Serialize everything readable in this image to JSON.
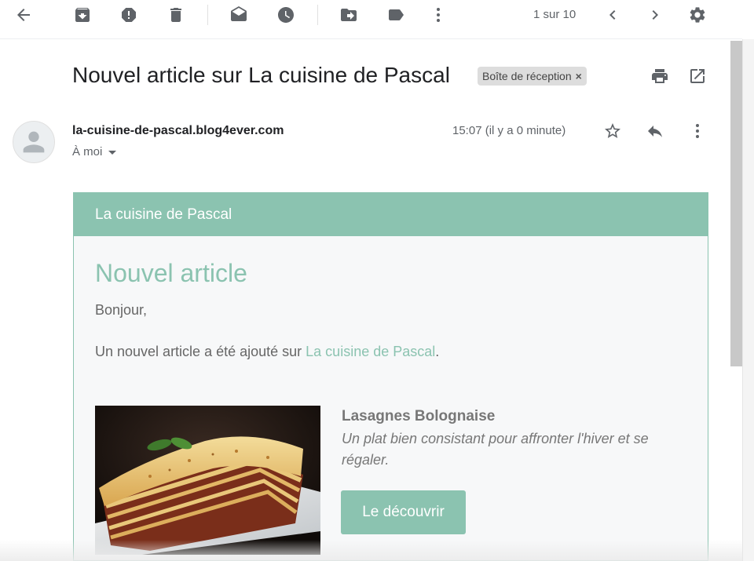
{
  "toolbar": {
    "icons": {
      "back": "arrow-left-icon",
      "archive": "archive-icon",
      "spam": "report-spam-icon",
      "delete": "trash-icon",
      "mark_unread": "mark-unread-icon",
      "snooze": "clock-icon",
      "move": "move-to-icon",
      "label": "label-icon",
      "more": "more-vert-icon",
      "prev": "chevron-left-icon",
      "next": "chevron-right-icon",
      "settings": "gear-icon"
    },
    "pager_text": "1 sur 10"
  },
  "email": {
    "subject": "Nouvel article sur La cuisine de Pascal",
    "label_chip": "Boîte de réception",
    "label_chip_close": "×",
    "sender": "la-cuisine-de-pascal.blog4ever.com",
    "recipient": "À moi",
    "timestamp": "15:07 (il y a 0 minute)"
  },
  "newsletter": {
    "header": "La cuisine de Pascal",
    "title": "Nouvel article",
    "greeting": "Bonjour,",
    "intro_before": "Un nouvel article a été ajouté sur ",
    "intro_link": "La cuisine de Pascal",
    "intro_after": ".",
    "article_title": "Lasagnes Bolognaise",
    "article_desc": "Un plat bien consistant pour affronter l'hiver et se régaler.",
    "cta_label": "Le découvrir"
  },
  "colors": {
    "accent": "#8bc3b0",
    "text_muted": "#777777",
    "chip_bg": "#dddddd"
  }
}
